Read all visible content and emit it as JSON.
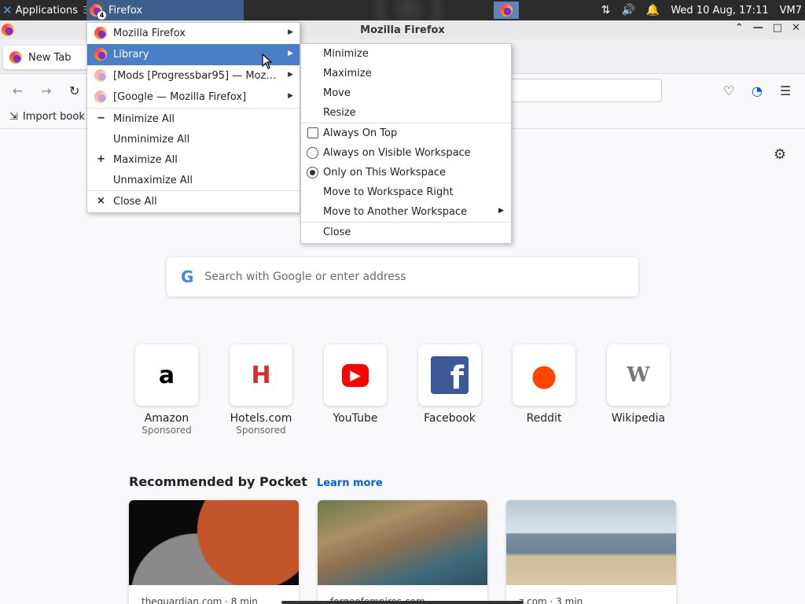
{
  "panel": {
    "applications_label": "Applications",
    "separator": "Ξ",
    "task_label": "Firefox",
    "task_count": "4",
    "clock": "Wed 10 Aug, 17:11",
    "user": "VM7"
  },
  "window": {
    "title": "Mozilla Firefox"
  },
  "tabs": [
    {
      "label": "New Tab"
    }
  ],
  "bookmarks": {
    "import_label": "Import book"
  },
  "search": {
    "placeholder": "Search with Google or enter address"
  },
  "top_sites": [
    {
      "name": "Amazon",
      "sub": "Sponsored",
      "glyph": "a",
      "color": "#000000"
    },
    {
      "name": "Hotels.com",
      "sub": "Sponsored",
      "glyph": "H",
      "color": "#d32f2f"
    },
    {
      "name": "YouTube",
      "sub": "",
      "glyph": "▶",
      "color": "#ff0000"
    },
    {
      "name": "Facebook",
      "sub": "",
      "glyph": "f",
      "color": "#3b5998"
    },
    {
      "name": "Reddit",
      "sub": "",
      "glyph": "●",
      "color": "#ff4500"
    },
    {
      "name": "Wikipedia",
      "sub": "",
      "glyph": "W",
      "color": "#777777"
    }
  ],
  "pocket": {
    "title": "Recommended by Pocket",
    "learn_more": "Learn more",
    "cards": [
      {
        "source": "theguardian.com · 8 min"
      },
      {
        "source": "forgeofempires.com"
      },
      {
        "source": "z.com · 3 min"
      }
    ]
  },
  "main_menu": {
    "windows": [
      {
        "label": "Mozilla Firefox",
        "selected": false
      },
      {
        "label": "Library",
        "selected": true
      },
      {
        "label": "[Mods [Progressbar95] — Moz…",
        "selected": false
      },
      {
        "label": "[Google — Mozilla Firefox]",
        "selected": false
      }
    ],
    "actions": [
      {
        "label": "Minimize All",
        "glyph": "−"
      },
      {
        "label": "Unminimize All",
        "glyph": ""
      },
      {
        "label": "Maximize All",
        "glyph": "+"
      },
      {
        "label": "Unmaximize All",
        "glyph": ""
      }
    ],
    "close_all": {
      "label": "Close All",
      "glyph": "×"
    }
  },
  "sub_menu": {
    "group1": [
      "Minimize",
      "Maximize",
      "Move",
      "Resize"
    ],
    "always_on_top": "Always On Top",
    "visible_workspace": "Always on Visible Workspace",
    "this_workspace": "Only on This Workspace",
    "move_right": "Move to Workspace Right",
    "move_another": "Move to Another Workspace",
    "close": "Close"
  },
  "colors": {
    "accent": "#4a7fc7",
    "panel": "#2b2b2b",
    "link": "#0060df"
  }
}
